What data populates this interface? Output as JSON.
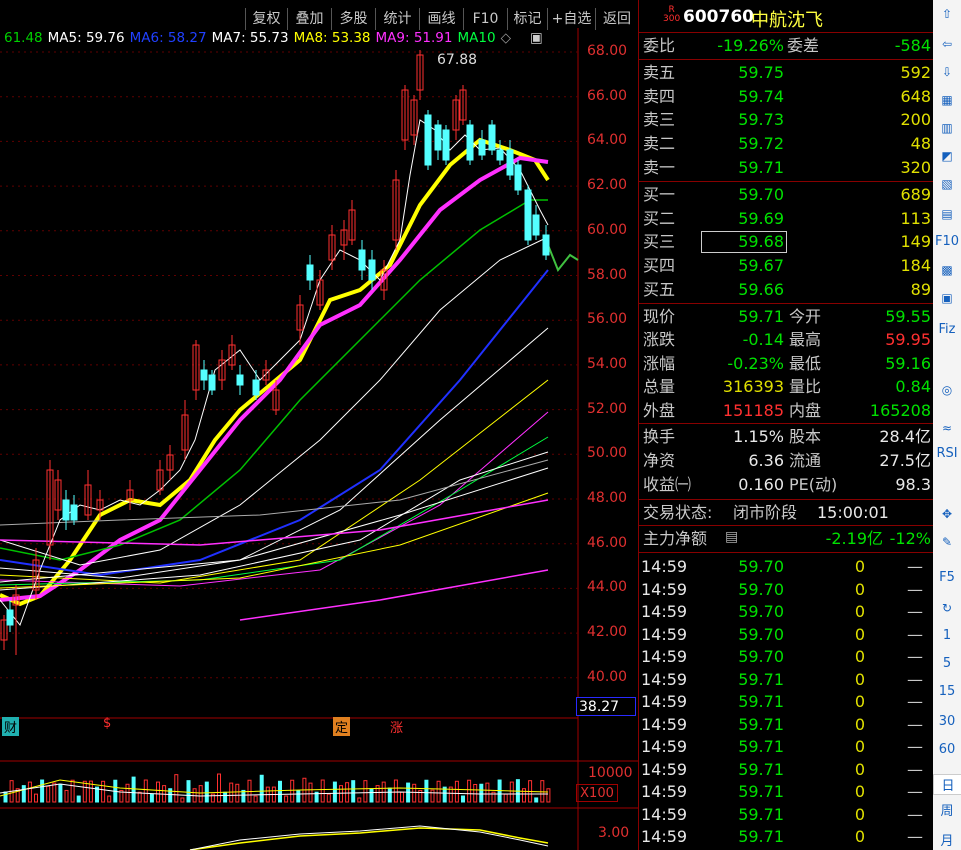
{
  "toolbar": [
    "复权",
    "叠加",
    "多股",
    "统计",
    "画线",
    "F10",
    "标记",
    "+自选",
    "返回"
  ],
  "ma": [
    {
      "label": "61.48",
      "color": "#00d000"
    },
    {
      "label": "MA5: 59.76",
      "color": "#ffffff"
    },
    {
      "label": "MA6: 58.27",
      "color": "#2040ff"
    },
    {
      "label": "MA7: 55.73",
      "color": "#ffffff"
    },
    {
      "label": "MA8: 53.38",
      "color": "#ffff00"
    },
    {
      "label": "MA9: 51.91",
      "color": "#ff30ff"
    },
    {
      "label": "MA10",
      "color": "#00ff40"
    }
  ],
  "price_ticks": [
    "68.00",
    "66.00",
    "64.00",
    "62.00",
    "60.00",
    "58.00",
    "56.00",
    "54.00",
    "52.00",
    "50.00",
    "48.00",
    "46.00",
    "44.00",
    "42.00",
    "40.00"
  ],
  "high_label": "67.88",
  "cursor_price": "38.27",
  "volume_tick": "10000",
  "volume_unit": "X100",
  "macd_tick": "3.00",
  "markers": [
    "财",
    "$",
    "定",
    "涨"
  ],
  "stock": {
    "code": "600760",
    "name": "中航沈飞",
    "badge_top": "R",
    "badge_bottom": "300"
  },
  "weibi": {
    "label": "委比",
    "value": "-19.26%",
    "diff_label": "委差",
    "diff": "-584"
  },
  "sells": [
    {
      "label": "卖五",
      "price": "59.75",
      "vol": "592"
    },
    {
      "label": "卖四",
      "price": "59.74",
      "vol": "648"
    },
    {
      "label": "卖三",
      "price": "59.73",
      "vol": "200"
    },
    {
      "label": "卖二",
      "price": "59.72",
      "vol": "48"
    },
    {
      "label": "卖一",
      "price": "59.71",
      "vol": "320"
    }
  ],
  "buys": [
    {
      "label": "买一",
      "price": "59.70",
      "vol": "689"
    },
    {
      "label": "买二",
      "price": "59.69",
      "vol": "113"
    },
    {
      "label": "买三",
      "price": "59.68",
      "vol": "149"
    },
    {
      "label": "买四",
      "price": "59.67",
      "vol": "184"
    },
    {
      "label": "买五",
      "price": "59.66",
      "vol": "89"
    }
  ],
  "quote": [
    {
      "l1": "现价",
      "v1": "59.71",
      "c1": "#00e000",
      "l2": "今开",
      "v2": "59.55",
      "c2": "#00e000"
    },
    {
      "l1": "涨跌",
      "v1": "-0.14",
      "c1": "#00e000",
      "l2": "最高",
      "v2": "59.95",
      "c2": "#ff3030"
    },
    {
      "l1": "涨幅",
      "v1": "-0.23%",
      "c1": "#00e000",
      "l2": "最低",
      "v2": "59.16",
      "c2": "#00e000"
    },
    {
      "l1": "总量",
      "v1": "316393",
      "c1": "#e0e000",
      "l2": "量比",
      "v2": "0.84",
      "c2": "#00e000"
    },
    {
      "l1": "外盘",
      "v1": "151185",
      "c1": "#ff3030",
      "l2": "内盘",
      "v2": "165208",
      "c2": "#00e000"
    }
  ],
  "fund": [
    {
      "l1": "换手",
      "v1": "1.15%",
      "l2": "股本",
      "v2": "28.4亿"
    },
    {
      "l1": "净资",
      "v1": "6.36",
      "l2": "流通",
      "v2": "27.5亿"
    },
    {
      "l1": "收益㈠",
      "v1": "0.160",
      "l2": "PE(动)",
      "v2": "98.3"
    }
  ],
  "status": {
    "label": "交易状态:",
    "value": "闭市阶段",
    "time": "15:00:01"
  },
  "main_flow": {
    "label": "主力净额",
    "value": "-2.19亿",
    "pct": "-12%"
  },
  "ticks": [
    {
      "t": "14:59",
      "p": "59.70",
      "v": "0",
      "d": "—"
    },
    {
      "t": "14:59",
      "p": "59.70",
      "v": "0",
      "d": "—"
    },
    {
      "t": "14:59",
      "p": "59.70",
      "v": "0",
      "d": "—"
    },
    {
      "t": "14:59",
      "p": "59.70",
      "v": "0",
      "d": "—"
    },
    {
      "t": "14:59",
      "p": "59.70",
      "v": "0",
      "d": "—"
    },
    {
      "t": "14:59",
      "p": "59.71",
      "v": "0",
      "d": "—"
    },
    {
      "t": "14:59",
      "p": "59.71",
      "v": "0",
      "d": "—"
    },
    {
      "t": "14:59",
      "p": "59.71",
      "v": "0",
      "d": "—"
    },
    {
      "t": "14:59",
      "p": "59.71",
      "v": "0",
      "d": "—"
    },
    {
      "t": "14:59",
      "p": "59.71",
      "v": "0",
      "d": "—"
    },
    {
      "t": "14:59",
      "p": "59.71",
      "v": "0",
      "d": "—"
    },
    {
      "t": "14:59",
      "p": "59.71",
      "v": "0",
      "d": "—"
    },
    {
      "t": "14:59",
      "p": "59.71",
      "v": "0",
      "d": "—"
    }
  ],
  "sidebar_text": [
    "F10",
    "Fiz",
    "RSI",
    "F5",
    "1",
    "5",
    "15",
    "30",
    "60",
    "日",
    "周",
    "月"
  ],
  "colors": {
    "up": "#ff3030",
    "down": "#54ffff",
    "bg": "#000000",
    "grid": "#800000"
  }
}
